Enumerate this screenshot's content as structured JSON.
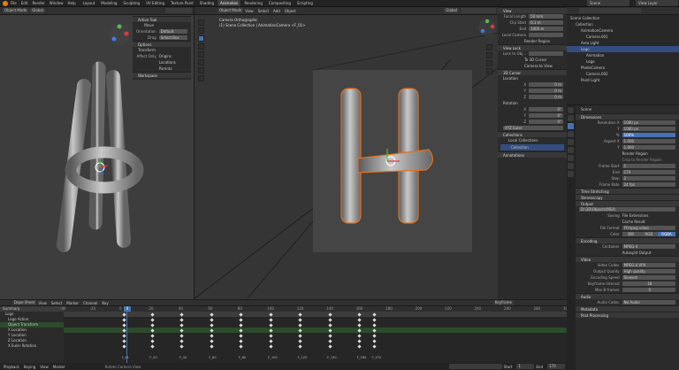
{
  "topbar": {
    "menus": [
      "File",
      "Edit",
      "Render",
      "Window",
      "Help"
    ],
    "workspaces": [
      "Layout",
      "Modeling",
      "Sculpting",
      "UV Editing",
      "Texture Paint",
      "Shading",
      "Animation",
      "Rendering",
      "Compositing",
      "Scripting"
    ],
    "active_workspace": "Animation",
    "scene": "Scene",
    "view_layer": "View Layer"
  },
  "left_view": {
    "mode": "Object Mode",
    "header_items": [
      "View",
      "Select",
      "Add",
      "Object"
    ],
    "orientation": "Global",
    "tool_panel": {
      "tab": "Active Tool",
      "tool": "Move",
      "orientation_label": "Orientation",
      "orientation_value": "Default",
      "drag_label": "Drag",
      "drag_value": "Select Box",
      "options": "Options",
      "transform": "Transform",
      "affect_only": "Affect Only",
      "origins": "Origins",
      "locations": "Locations",
      "parents": "Parents",
      "workspace": "Workspace"
    }
  },
  "mid_view": {
    "mode": "Object Mode",
    "header_items": [
      "View",
      "Select",
      "Add",
      "Object"
    ],
    "orientation": "Global",
    "title": "Camera Orthographic",
    "subtitle": "(1) Scene Collection | AnimationCamera <F_01>"
  },
  "npanel": {
    "view_title": "View",
    "focal_label": "Focal Length",
    "focal_value": "50 mm",
    "clip_label": "Clip Start",
    "clip_start": "0.1 m",
    "end_label": "End",
    "clip_end": "1000 m",
    "local_camera": "Local Camera",
    "render_region": "Render Region",
    "view_lock": "View Lock",
    "lock_obj": "Lock to Obj...",
    "lock_cursor": "To 3D Cursor",
    "camera_to_view": "Camera to View",
    "cursor_title": "3D Cursor",
    "location": "Location",
    "rotation": "Rotation",
    "axes": [
      "X",
      "Y",
      "Z"
    ],
    "loc_values": [
      "0 m",
      "0 m",
      "0 m"
    ],
    "rot_values": [
      "0°",
      "0°",
      "0°"
    ],
    "rot_mode": "XYZ Euler",
    "collections": "Collections",
    "local_collections": "Local Collections",
    "collection": "Collection",
    "annotations": "Annotations"
  },
  "outliner": {
    "title": "Scene Collection",
    "items": [
      {
        "label": "Collection",
        "depth": 1,
        "sel": false
      },
      {
        "label": "AnimationCamera",
        "depth": 2,
        "sel": false
      },
      {
        "label": "Camera.001",
        "depth": 3,
        "sel": false
      },
      {
        "label": "Area Light",
        "depth": 2,
        "sel": false
      },
      {
        "label": "Logo",
        "depth": 2,
        "sel": true
      },
      {
        "label": "Animation",
        "depth": 3,
        "sel": false
      },
      {
        "label": "Logo",
        "depth": 3,
        "sel": false
      },
      {
        "label": "PhotoCamera",
        "depth": 2,
        "sel": false
      },
      {
        "label": "Camera.002",
        "depth": 3,
        "sel": false
      },
      {
        "label": "Point Light",
        "depth": 2,
        "sel": false
      }
    ]
  },
  "props": {
    "scene": "Scene",
    "dimensions": "Dimensions",
    "res_x_label": "Resolution X",
    "res_x": "1080 px",
    "res_y_label": "Y",
    "res_y": "1080 px",
    "pct_label": "%",
    "pct": "100%",
    "aspect_x_label": "Aspect X",
    "aspect_x": "1.000",
    "aspect_y_label": "Y",
    "aspect_y": "1.000",
    "render_region": "Render Region",
    "crop": "Crop to Render Region",
    "frame_start_label": "Frame Start",
    "frame_start": "1",
    "end_label": "End",
    "frame_end": "170",
    "step_label": "Step",
    "step": "1",
    "fps_label": "Frame Rate",
    "fps": "24 fps",
    "time_stretching": "Time Stretching",
    "stereoscopy": "Stereoscopy",
    "output": "Output",
    "path": "D:\\3D\\Objects\\MS4\\",
    "saving_label": "Saving",
    "file_ext": "File Extensions",
    "cache_result": "Cache Result",
    "file_format_label": "File Format",
    "file_format": "FFmpeg video",
    "color_label": "Color",
    "color_modes": [
      "BW",
      "RGB",
      "RGBA"
    ],
    "encoding": "Encoding",
    "container_label": "Container",
    "container": "MPEG-4",
    "autosplit": "Autosplit Output",
    "video": "Video",
    "codec_label": "Video Codec",
    "codec": "MPEG-4 VPX",
    "quality_label": "Output Quality",
    "quality": "High quality",
    "speed_label": "Encoding Speed",
    "speed": "Slowest",
    "keyframe_label": "Keyframe Interval",
    "keyframe": "18",
    "maxb_label": "Max B-frames",
    "maxb": "0",
    "audio": "Audio",
    "audio_codec_label": "Audio Codec",
    "audio_codec": "No Audio",
    "metadata": "Metadata",
    "post": "Post Processing"
  },
  "timeline": {
    "editor": "Dope Sheet",
    "menus": [
      "View",
      "Select",
      "Marker",
      "Channel",
      "Key"
    ],
    "mode": "Keyframe",
    "current_frame": "0",
    "ticks": [
      "-40",
      "-20",
      "0",
      "20",
      "40",
      "60",
      "80",
      "100",
      "120",
      "140",
      "160",
      "180",
      "200",
      "220",
      "240",
      "260",
      "280",
      "300"
    ],
    "channels": [
      "Summary",
      "Logo",
      "Logo Action",
      "Object Transform",
      "X Location",
      "Y Location",
      "Z Location",
      "X Euler Rotation"
    ],
    "keyframe_labels": [
      "F_01",
      "F_20",
      "F_40",
      "F_60",
      "F_80",
      "F_100",
      "F_120",
      "F_140",
      "F_160",
      "F_170"
    ],
    "status_left": "Playback",
    "status_items": [
      "Keying",
      "View",
      "Marker"
    ],
    "status_mid": "Rotate Camera View",
    "start_label": "Start",
    "start": "1",
    "end_label": "End",
    "end": "170"
  }
}
